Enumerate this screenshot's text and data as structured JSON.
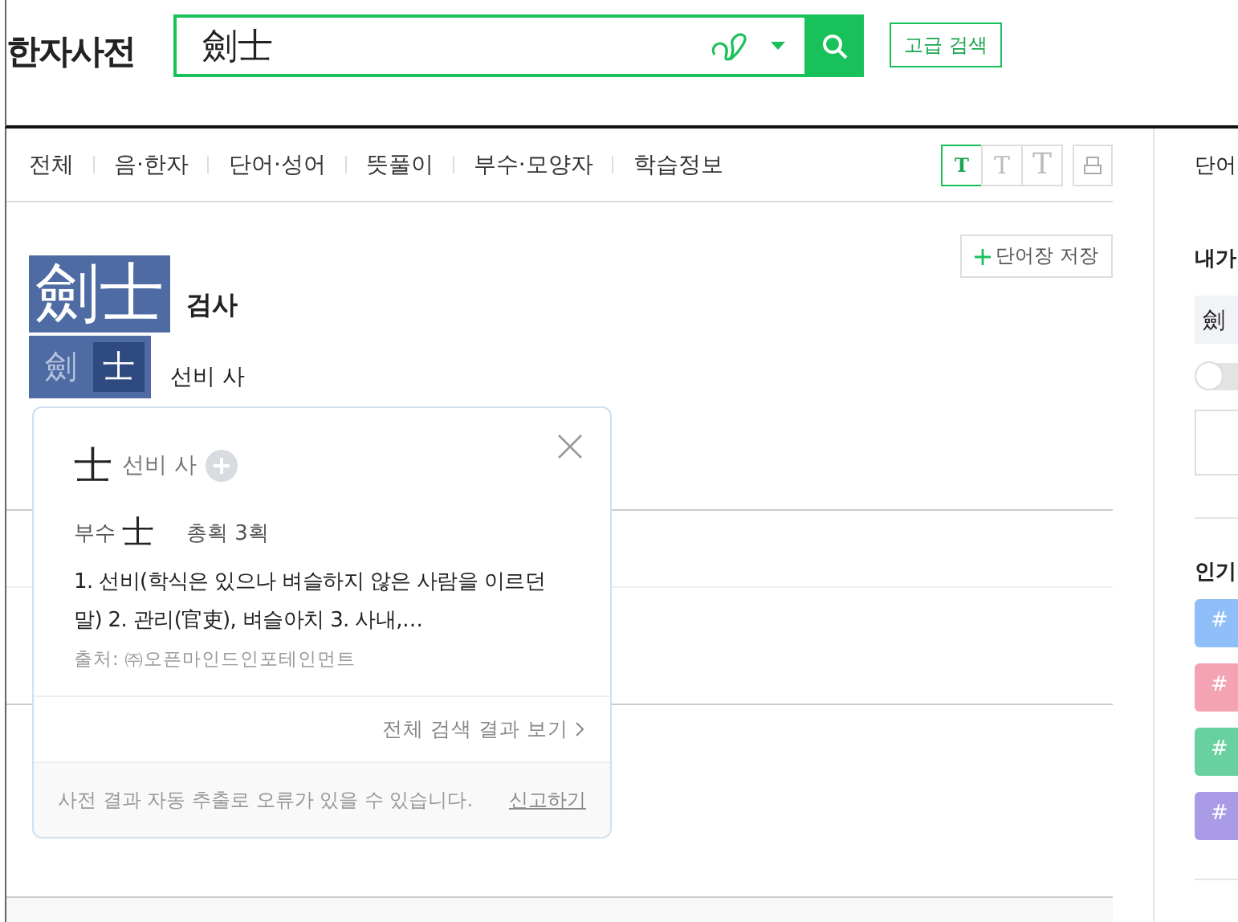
{
  "header": {
    "logo": "한자사전",
    "search": {
      "value": "劍士"
    },
    "advanced_button": "고급 검색"
  },
  "nav": {
    "tabs": [
      "전체",
      "음·한자",
      "단어·성어",
      "뜻풀이",
      "부수·모양자",
      "학습정보"
    ],
    "font_sizes": [
      {
        "label": "T",
        "selected": true
      },
      {
        "label": "T",
        "selected": false
      },
      {
        "label": "T",
        "selected": false
      }
    ]
  },
  "entry": {
    "save_button": "단어장 저장",
    "word": "劍士",
    "reading": "검사",
    "characters": [
      {
        "char": "劍",
        "selected": false
      },
      {
        "char": "士",
        "selected": true
      }
    ],
    "meaning": "선비 사"
  },
  "popup": {
    "char": "士",
    "meaning": "선비 사",
    "radical_label": "부수",
    "radical": "士",
    "strokes": "총획 3획",
    "definition": "1. 선비(학식은 있으나 벼슬하지 않은 사람을 이르던 말) 2. 관리(官吏), 벼슬아치 3. 사내,…",
    "source": "출처: ㈜오픈마인드인포테인먼트",
    "more_link": "전체 검색 결과 보기",
    "notice": "사전 결과 자동 추출로 오류가 있을 수 있습니다.",
    "report_link": "신고하기"
  },
  "sidebar": {
    "tab": "단어",
    "heading_1": "내가",
    "input_value": "劍",
    "toggle": {
      "on": false
    },
    "heading_2": "인기",
    "tags": [
      {
        "label": "#",
        "color": "#8fbef8"
      },
      {
        "label": "#",
        "color": "#f4a3b4"
      },
      {
        "label": "#",
        "color": "#69d19f"
      },
      {
        "label": "#",
        "color": "#a99be6"
      }
    ]
  }
}
